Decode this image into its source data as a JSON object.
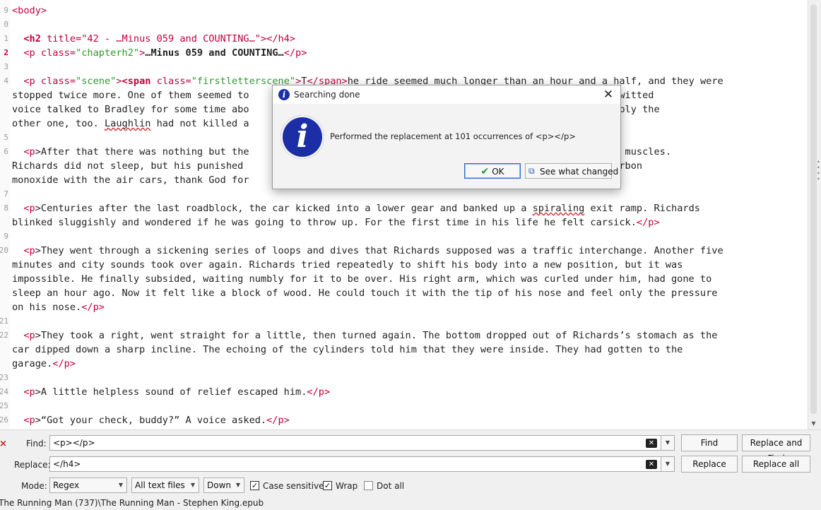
{
  "editor": {
    "line_numbers": [
      "9",
      "0",
      "1",
      "2",
      "3",
      "4",
      "",
      "",
      "",
      "5",
      "6",
      "",
      "",
      "7",
      "8",
      "",
      "9",
      "20",
      "",
      "",
      "",
      "",
      "21",
      "22",
      "",
      "",
      "23",
      "24",
      "25",
      "26"
    ],
    "current_line": "2",
    "lines": {
      "body_tag": "<body>",
      "h2_open": "<h2",
      "h2_attr": " title=",
      "h2_val": "\"42 - …Minus 059 and COUNTING…\"",
      "h2_close": "></h4>",
      "p_open": "<p",
      "p_attr": " class=",
      "p_val": "\"chapterh2\"",
      "p_gt": ">",
      "p_text": "…Minus 059 and COUNTING…",
      "p_close": "</p>",
      "scene_p": "<p",
      "scene_attr": " class=",
      "scene_val": "\"scene\"",
      "scene_gt": ">",
      "span_open": "<span",
      "span_attr": " class=",
      "span_val": "\"firstletterscene\"",
      "span_gt": ">",
      "span_text": "T",
      "span_close": "</span>",
      "s1": "he ride seemed much longer than an hour and a half, and they were",
      "s2": "stopped twice more. One of them seemed to                                              g cop with a dull-witted",
      "s3": "voice talked to Bradley for some time abo                                              Richards and probably the",
      "s4a": "other one, too. ",
      "s4b": "Laughlin",
      "s4c": " had not killed a                                              Topeka.",
      "a1a": ">After that there was nothing but the                                            n cramped and frozen muscles.",
      "a2": "Richards did not sleep, but his punished                                              ss. There was no carbon",
      "a3": "monoxide with the air cars, thank God for",
      "c1a": ">Centuries after the last roadblock, the car kicked into a lower gear and banked up a ",
      "c1b": "spiraling",
      "c1c": " exit ramp. Richards",
      "c2": "blinked sluggishly and wondered if he was going to throw up. For the first time in his life he felt carsick.",
      "t1": ">They went through a sickening series of loops and dives that Richards supposed was a traffic interchange. Another five",
      "t2": "minutes and city sounds took over again. Richards tried repeatedly to shift his body into a new position, but it was",
      "t3": "impossible. He finally subsided, waiting numbly for it to be over. His right arm, which was curled under him, had gone to",
      "t4": "sleep an hour ago. Now it felt like a block of wood. He could touch it with the tip of his nose and feel only the pressure",
      "t5": "on his nose.",
      "r1": ">They took a right, went straight for a little, then turned again. The bottom dropped out of Richards’s stomach as the",
      "r2": "car dipped down a sharp incline. The echoing of the cylinders told him that they were inside. They had gotten to the",
      "r3": "garage.",
      "h1": ">A little helpless sound of relief escaped him.",
      "g1": ">“Got your check, buddy?” A voice asked.",
      "p_tag": "<p",
      "close_p": "</p>"
    }
  },
  "dialog": {
    "title": "Searching done",
    "close_glyph": "✕",
    "icon_glyph": "i",
    "message": "Performed the replacement at 101 occurrences of <p></p>",
    "ok_label": "OK",
    "see_changes_label": "See what changed"
  },
  "find_panel": {
    "find_label": "Find:",
    "find_value": "<p></p>",
    "replace_label": "Replace:",
    "replace_value": "</h4>",
    "find_button": "Find",
    "replace_and_find_button": "Replace and Find",
    "replace_button": "Replace",
    "replace_all_button": "Replace all",
    "mode_label": "Mode:",
    "mode_value": "Regex",
    "scope_value": "All text files",
    "direction_value": "Down",
    "case_sensitive_label": "Case sensitive",
    "case_sensitive_checked": true,
    "wrap_label": "Wrap",
    "wrap_checked": true,
    "dot_all_label": "Dot all",
    "dot_all_checked": false
  },
  "status": {
    "path": "The Running Man (737)\\The Running Man - Stephen King.epub"
  }
}
